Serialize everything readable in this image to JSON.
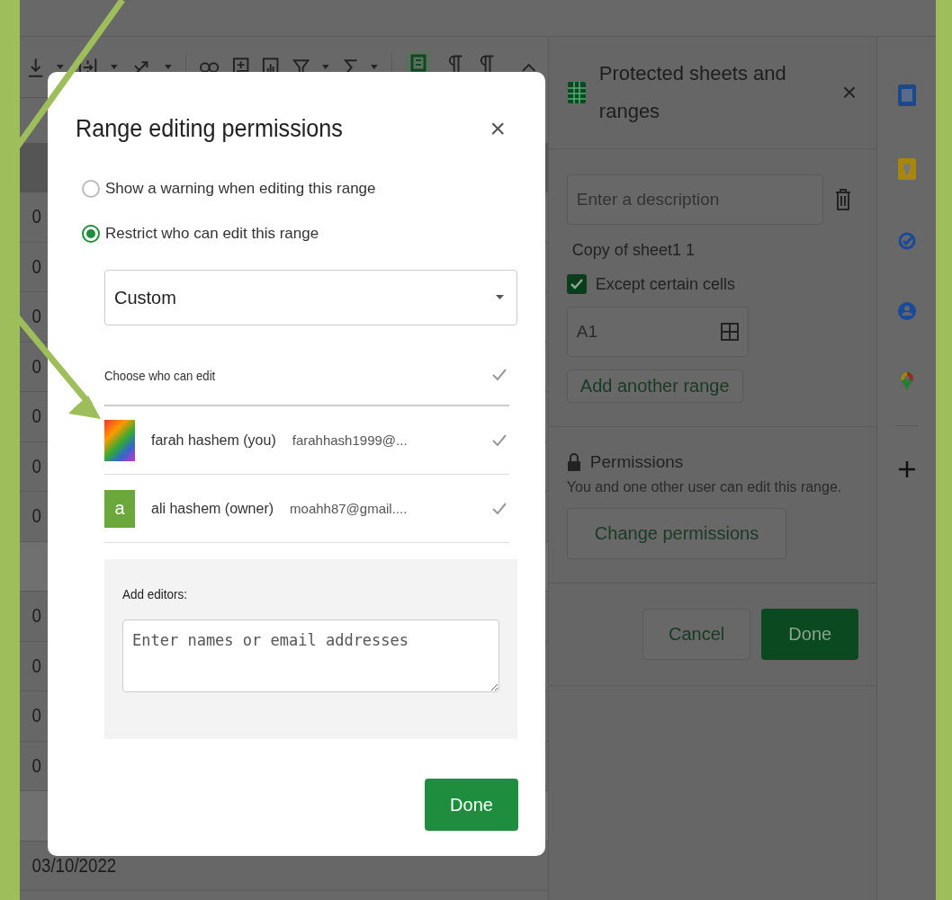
{
  "grid": {
    "rows": [
      {
        "kind": "value",
        "text": "0"
      },
      {
        "kind": "value",
        "text": "0"
      },
      {
        "kind": "value",
        "text": "0"
      },
      {
        "kind": "value",
        "text": "0"
      },
      {
        "kind": "value",
        "text": "0"
      },
      {
        "kind": "value",
        "text": "0"
      },
      {
        "kind": "value",
        "text": "0"
      },
      {
        "kind": "blank"
      },
      {
        "kind": "value",
        "text": "0"
      },
      {
        "kind": "value",
        "text": "0"
      },
      {
        "kind": "value",
        "text": "0"
      },
      {
        "kind": "value",
        "text": "0"
      },
      {
        "kind": "blank"
      },
      {
        "kind": "value",
        "text": "03/10/2022"
      }
    ]
  },
  "side_panel": {
    "title": "Protected sheets and ranges",
    "close": "×",
    "description": {
      "placeholder": "Enter a description"
    },
    "sheet_name": "Copy of sheet1 1",
    "except_cells": {
      "label": "Except certain cells",
      "checked": true
    },
    "range": {
      "value": "A1"
    },
    "add_range": "Add another range",
    "permissions_title": "Permissions",
    "permissions_text": "You and one other user can edit this range.",
    "change_permissions": "Change permissions",
    "cancel": "Cancel",
    "done": "Done"
  },
  "dialog": {
    "title": "Range editing permissions",
    "close": "×",
    "options": [
      {
        "label": "Show a warning when editing this range",
        "selected": false
      },
      {
        "label": "Restrict who can edit this range",
        "selected": true
      }
    ],
    "dropdown": {
      "value": "Custom"
    },
    "choose_label": "Choose who can edit",
    "choose_all_checked": true,
    "editors": [
      {
        "kind": "photo",
        "name": "farah hashem (you)",
        "email": "farahhash1999@...",
        "checked": true
      },
      {
        "kind": "letter",
        "initial": "a",
        "name": "ali hashem (owner)",
        "email": "moahh87@gmail....",
        "checked": true
      }
    ],
    "add_editors": {
      "label": "Add editors:",
      "placeholder": "Enter names or email addresses"
    },
    "done": "Done"
  }
}
